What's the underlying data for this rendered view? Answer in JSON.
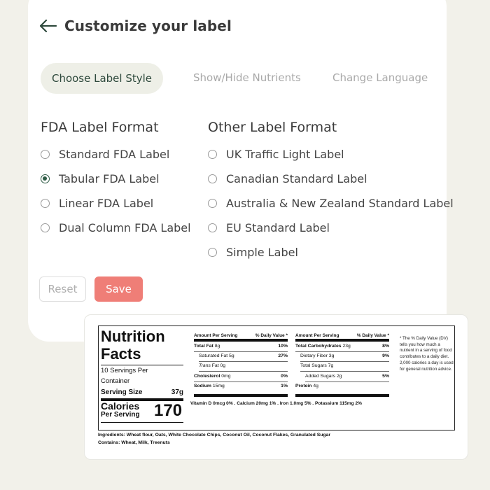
{
  "header": {
    "title": "Customize your label"
  },
  "tabs": [
    {
      "label": "Choose Label Style",
      "active": true
    },
    {
      "label": "Show/Hide Nutrients",
      "active": false
    },
    {
      "label": "Change Language",
      "active": false
    }
  ],
  "fda": {
    "title": "FDA Label Format",
    "options": [
      {
        "label": "Standard FDA Label",
        "selected": false
      },
      {
        "label": "Tabular FDA Label",
        "selected": true
      },
      {
        "label": "Linear FDA Label",
        "selected": false
      },
      {
        "label": "Dual Column FDA Label",
        "selected": false
      }
    ]
  },
  "other": {
    "title": "Other Label Format",
    "options": [
      {
        "label": "UK Traffic Light Label",
        "selected": false
      },
      {
        "label": "Canadian Standard Label",
        "selected": false
      },
      {
        "label": "Australia & New Zealand Standard Label",
        "selected": false
      },
      {
        "label": "EU Standard Label",
        "selected": false
      },
      {
        "label": "Simple Label",
        "selected": false
      }
    ]
  },
  "buttons": {
    "reset": "Reset",
    "save": "Save"
  },
  "colors": {
    "accent": "#ef7e77",
    "radio_selected": "#2f5c46",
    "background": "#f2f1ea"
  },
  "nutrition": {
    "title_line1": "Nutrition",
    "title_line2": "Facts",
    "servings_line1": "10 Servings Per",
    "servings_line2": "Container",
    "serving_size_label": "Serving Size",
    "serving_size_value": "37g",
    "calories_label": "Calories",
    "per_serving": "Per Serving",
    "calories_value": "170",
    "left_col": {
      "head": "Amount Per Serving",
      "dv_head": "% Daily Value *",
      "rows": [
        {
          "name": "Total Fat",
          "amount": "8g",
          "dv": "10%",
          "bold": true,
          "indent": 0
        },
        {
          "name": "Saturated Fat",
          "amount": "5g",
          "dv": "27%",
          "bold": false,
          "indent": 1
        },
        {
          "name": "Trans",
          "name_suffix": "Fat",
          "amount": "0g",
          "dv": "",
          "bold": false,
          "indent": 1,
          "italic": true
        },
        {
          "name": "Cholesterol",
          "amount": "0mg",
          "dv": "0%",
          "bold": true,
          "indent": 0
        },
        {
          "name": "Sodium",
          "amount": "15mg",
          "dv": "1%",
          "bold": true,
          "indent": 0
        }
      ]
    },
    "right_col": {
      "head": "Amount Per Serving",
      "dv_head": "% Daily Value *",
      "rows": [
        {
          "name": "Total Carbohydrates",
          "amount": "23g",
          "dv": "8%",
          "bold": true,
          "indent": 0
        },
        {
          "name": "Dietary Fiber",
          "amount": "3g",
          "dv": "9%",
          "bold": false,
          "indent": 1
        },
        {
          "name": "Total Sugars",
          "amount": "7g",
          "dv": "",
          "bold": false,
          "indent": 1
        },
        {
          "name": "Added Sugars",
          "amount": "2g",
          "dv": "5%",
          "bold": false,
          "indent": 2
        },
        {
          "name": "Protein",
          "amount": "4g",
          "dv": "",
          "bold": true,
          "indent": 0
        }
      ]
    },
    "vitamins": "Vitamin D 0mcg 0% . Calcium 20mg 1% . Iron 1.0mg 5% . Potassium 115mg 2%",
    "footnote": "* The % Daily Value (DV) tells you how much a nutrient in a serving of food contributes to a daily diet. 2,000 calories a day is used for general nutrition advice.",
    "ingredients_label": "Ingredients:",
    "ingredients": "Wheat flour, Oats, White Chocolate Chips, Coconut Oil, Coconut Flakes, Granulated Sugar",
    "contains_label": "Contains:",
    "contains": "Wheat, Milk, Treenuts"
  }
}
